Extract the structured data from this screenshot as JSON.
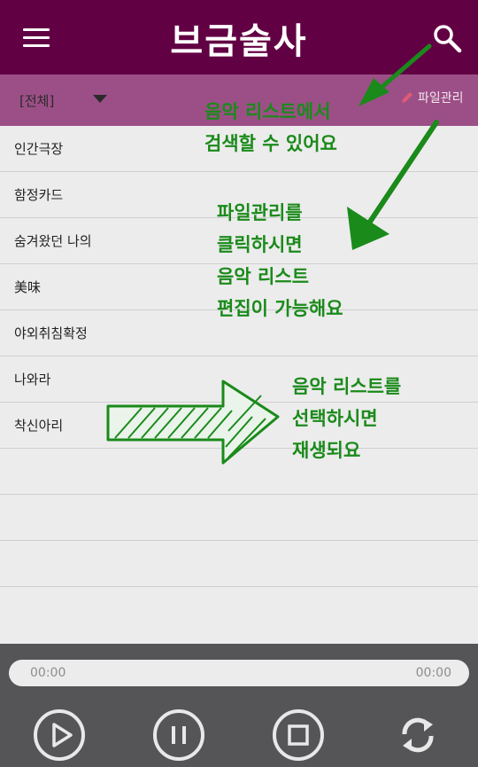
{
  "header": {
    "title": "브금술사",
    "icons": [
      "menu-icon",
      "search-icon"
    ]
  },
  "toolbar": {
    "category": "[전체]",
    "file_manage": "파일관리",
    "icons": [
      "dropdown-icon",
      "pencil-icon"
    ]
  },
  "tracks": [
    {
      "title": "인간극장"
    },
    {
      "title": "함정카드"
    },
    {
      "title": "숨겨왔던 나의"
    },
    {
      "title": "美味"
    },
    {
      "title": "야외취침확정"
    },
    {
      "title": "나와라"
    },
    {
      "title": "착신아리"
    }
  ],
  "player": {
    "time_current": "00:00",
    "time_total": "00:00",
    "controls": [
      "play-icon",
      "pause-icon",
      "stop-icon",
      "repeat-icon"
    ]
  },
  "annotations": {
    "search_note": {
      "line1": "음악 리스트에서",
      "line2": "검색할 수 있어요"
    },
    "file_note": {
      "line1": "파일관리를",
      "line2": "클릭하시면",
      "line3": "음악 리스트",
      "line4": "편집이 가능해요"
    },
    "select_note": {
      "line1": "음악 리스트를",
      "line2": "선택하시면",
      "line3": "재생되요"
    }
  },
  "colors": {
    "header": "#620044",
    "filterbar": "#9c4f86",
    "annotation": "#1a8a1a",
    "player": "#555557"
  }
}
